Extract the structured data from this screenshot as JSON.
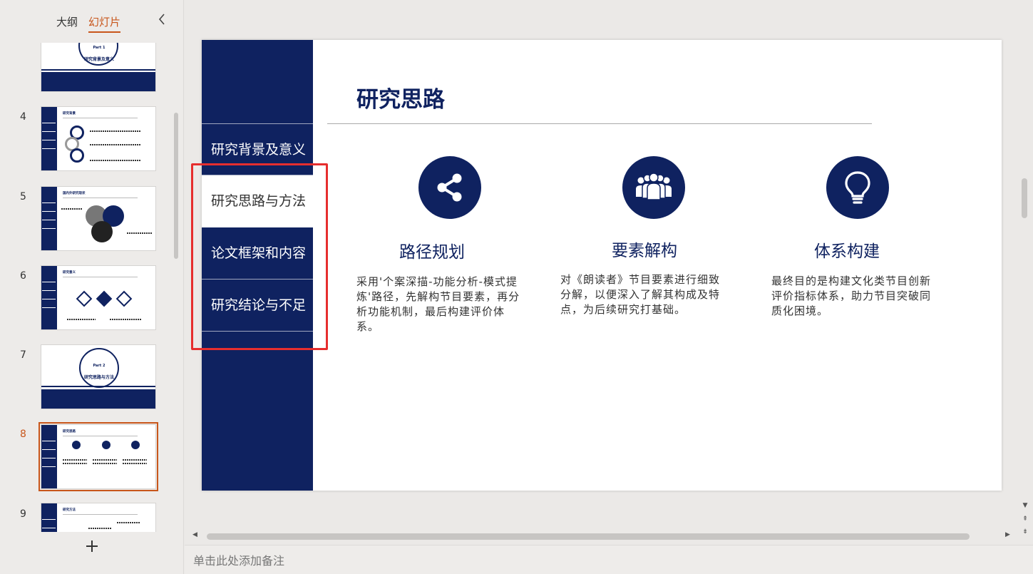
{
  "panel": {
    "tab_outline": "大纲",
    "tab_slides": "幻灯片",
    "collapse_icon": "chevron-left-icon",
    "add_icon": "plus-icon"
  },
  "thumbnails": [
    {
      "num": "",
      "title": "研究背景及意义",
      "part": "Part 1",
      "kind": "part"
    },
    {
      "num": "4",
      "title": "研究背景",
      "kind": "list"
    },
    {
      "num": "5",
      "title": "国内外研究现状",
      "kind": "circles"
    },
    {
      "num": "6",
      "title": "研究意义",
      "kind": "diamonds"
    },
    {
      "num": "7",
      "title": "研究思路与方法",
      "part": "Part 2",
      "kind": "part"
    },
    {
      "num": "8",
      "title": "研究思路",
      "kind": "icons",
      "selected": true
    },
    {
      "num": "9",
      "title": "研究方法",
      "kind": "list2"
    }
  ],
  "slide": {
    "title": "研究思路",
    "nav": [
      {
        "label": "研究背景及意义",
        "active": false
      },
      {
        "label": "研究思路与方法",
        "active": true
      },
      {
        "label": "论文框架和内容",
        "active": false
      },
      {
        "label": "研究结论与不足",
        "active": false
      }
    ],
    "columns": [
      {
        "icon": "share-icon",
        "heading": "路径规划",
        "body": "采用'个案深描-功能分析-模式提炼'路径，先解构节目要素，再分析功能机制，最后构建评价体系。"
      },
      {
        "icon": "people-group-icon",
        "heading": "要素解构",
        "body": "对《朗读者》节目要素进行细致分解，以便深入了解其构成及特点，为后续研究打基础。"
      },
      {
        "icon": "lightbulb-icon",
        "heading": "体系构建",
        "body": "最终目的是构建文化类节目创新评价指标体系，助力节目突破同质化困境。"
      }
    ]
  },
  "notes": {
    "placeholder": "单击此处添加备注"
  },
  "colors": {
    "navy": "#0f2260",
    "accent": "#c8561b",
    "highlight": "#e62e2e"
  }
}
